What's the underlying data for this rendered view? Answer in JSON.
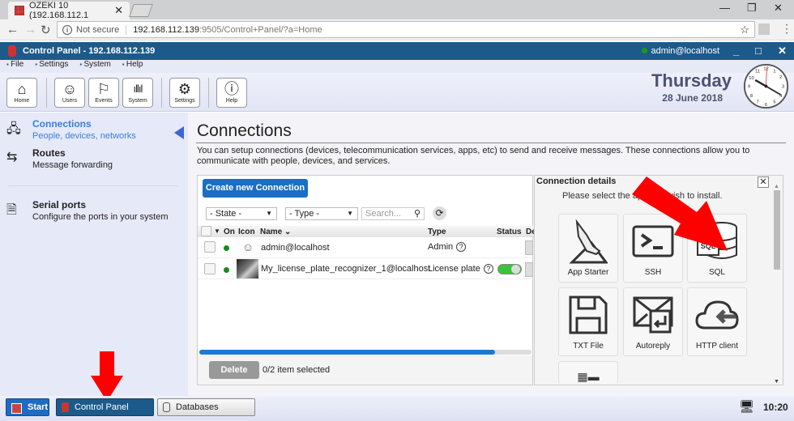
{
  "browser": {
    "tab_title": "OZEKI 10 (192.168.112.1",
    "url_not_secure": "Not secure",
    "url_host": "192.168.112.139",
    "url_path": ":9505/Control+Panel/?a=Home"
  },
  "app": {
    "title": "Control Panel - 192.168.112.139",
    "user": "admin@localhost",
    "menu": [
      "File",
      "Settings",
      "System",
      "Help"
    ],
    "toolbar": [
      {
        "label": "Home",
        "icon": "home-icon"
      },
      {
        "label": "Users",
        "icon": "user-icon"
      },
      {
        "label": "Events",
        "icon": "flag-icon"
      },
      {
        "label": "System",
        "icon": "bar-chart-icon"
      },
      {
        "label": "Settings",
        "icon": "gear-icon"
      },
      {
        "label": "Help",
        "icon": "info-icon"
      }
    ],
    "day": "Thursday",
    "date": "28 June 2018",
    "clock_time": "10:20"
  },
  "sidebar": {
    "items": [
      {
        "title": "Connections",
        "subtitle": "People, devices, networks",
        "active": true
      },
      {
        "title": "Routes",
        "subtitle": "Message forwarding"
      },
      {
        "title": "Serial ports",
        "subtitle": "Configure the ports in your system"
      }
    ]
  },
  "main": {
    "title": "Connections",
    "description": "You can setup connections (devices, telecommunication services, apps, etc) to send and receive messages. These connections allow you to communicate with people, devices, and services.",
    "create_button": "Create new Connection",
    "filter_state": "- State -",
    "filter_type": "- Type -",
    "search_placeholder": "Search...",
    "columns": [
      "On",
      "Icon",
      "Name",
      "Type",
      "Status",
      "De"
    ],
    "rows": [
      {
        "name": "admin@localhost",
        "type": "Admin",
        "on": true,
        "status_toggle": false
      },
      {
        "name": "My_license_plate_recognizer_1@localhost",
        "type": "License plate",
        "on": true,
        "status_toggle": true
      }
    ],
    "scroll_progress": 0.89,
    "delete_button": "Delete",
    "selection_status": "0/2 item selected"
  },
  "details": {
    "title": "Connection details",
    "subtitle": "Please select the app you wish to install.",
    "apps": [
      {
        "label": "App Starter",
        "icon": "shoe-icon"
      },
      {
        "label": "SSH",
        "icon": "terminal-icon"
      },
      {
        "label": "SQL",
        "icon": "database-icon"
      },
      {
        "label": "TXT File",
        "icon": "floppy-icon"
      },
      {
        "label": "Autoreply",
        "icon": "envelope-reply-icon"
      },
      {
        "label": "HTTP client",
        "icon": "cloud-icon"
      },
      {
        "label": "",
        "icon": "table-icon"
      }
    ]
  },
  "taskbar": {
    "start": "Start",
    "items": [
      "Control Panel",
      "Databases"
    ],
    "time": "10:20"
  }
}
